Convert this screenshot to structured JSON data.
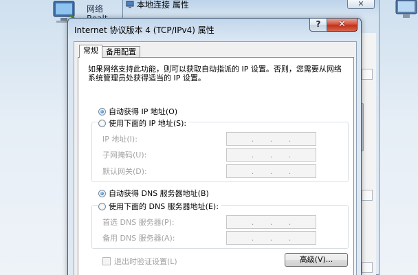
{
  "background": {
    "desktop_left_label": "网络",
    "desktop_left_label2": "Realt",
    "window_title": "本地连接 属性",
    "close_glyph": "✕"
  },
  "dialog": {
    "title": "Internet 协议版本 4 (TCP/IPv4) 属性",
    "help_glyph": "?",
    "close_glyph": "✕",
    "tabs": [
      {
        "label": "常规",
        "active": true
      },
      {
        "label": "备用配置",
        "active": false
      }
    ],
    "description": "如果网络支持此功能，则可以获取自动指派的 IP 设置。否则，您需要从网络系统管理员处获得适当的 IP 设置。",
    "ip_section": {
      "auto_label": "自动获得 IP 地址(O)",
      "manual_label": "使用下面的 IP 地址(S):",
      "selected": "auto",
      "fields": [
        {
          "label": "IP 地址(I):",
          "value": ". . ."
        },
        {
          "label": "子网掩码(U):",
          "value": ". . ."
        },
        {
          "label": "默认网关(D):",
          "value": ". . ."
        }
      ]
    },
    "dns_section": {
      "auto_label": "自动获得 DNS 服务器地址(B)",
      "manual_label": "使用下面的 DNS 服务器地址(E):",
      "selected": "auto",
      "fields": [
        {
          "label": "首选 DNS 服务器(P):",
          "value": ". . ."
        },
        {
          "label": "备用 DNS 服务器(A):",
          "value": ". . ."
        }
      ]
    },
    "validate_label": "退出时验证设置(L)",
    "advanced_label": "高级(V)..."
  }
}
